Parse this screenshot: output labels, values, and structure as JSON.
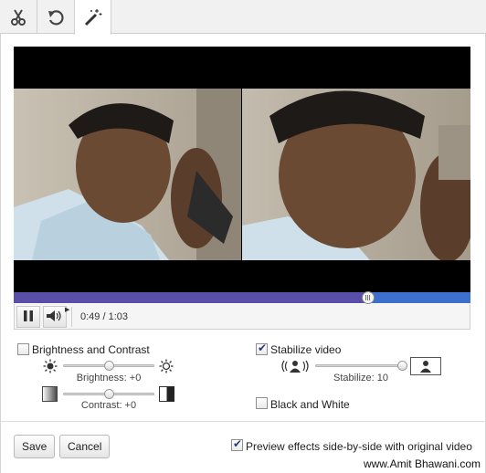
{
  "tabs": [
    {
      "icon": "scissors-icon",
      "active": false
    },
    {
      "icon": "rotate-icon",
      "active": false
    },
    {
      "icon": "magic-wand-icon",
      "active": true
    }
  ],
  "player": {
    "progress_fraction": 0.775,
    "time_display": "0:49 / 1:03",
    "play_state": "playing"
  },
  "effects": {
    "brightness_contrast": {
      "label": "Brightness and Contrast",
      "checked": false,
      "brightness_label": "Brightness: +0",
      "brightness_value": 0,
      "contrast_label": "Contrast: +0",
      "contrast_value": 0
    },
    "stabilize": {
      "label": "Stabilize video",
      "checked": true,
      "value_label": "Stabilize: 10",
      "value": 10
    },
    "black_white": {
      "label": "Black and White",
      "checked": false
    },
    "preview": {
      "label": "Preview effects side-by-side with original video",
      "checked": true
    }
  },
  "buttons": {
    "save": "Save",
    "cancel": "Cancel"
  },
  "watermark": "www.Amit Bhawani.com"
}
